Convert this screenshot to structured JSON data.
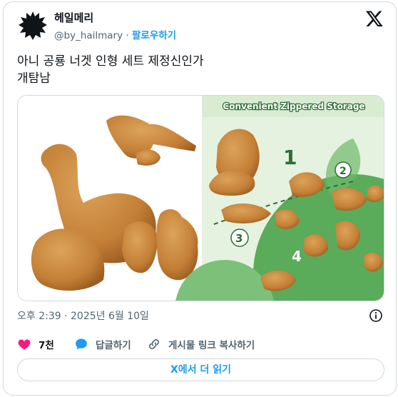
{
  "author": {
    "name": "헤일메리",
    "handle": "@by_hailmary",
    "separator": "·",
    "follow_label": "팔로우하기"
  },
  "tweet": {
    "text_line1": "아니 공룡 너겟 인형 세트 제정신인가",
    "text_line2": "개탐남"
  },
  "media": {
    "banner_text": "Convenient Zippered Storage",
    "step_numbers": [
      "1",
      "2",
      "3",
      "4"
    ]
  },
  "meta": {
    "timestamp": "오후 2:39 · 2025년 6월 10일"
  },
  "actions": {
    "like_count": "7천",
    "reply_label": "답글하기",
    "copy_link_label": "게시물 링크 복사하기"
  },
  "read_more_label": "X에서 더 읽기",
  "colors": {
    "accent": "#1d9bf0",
    "like": "#f91880",
    "muted": "#536471",
    "nugget": "#c8843a",
    "green": "#3f9a4a"
  }
}
